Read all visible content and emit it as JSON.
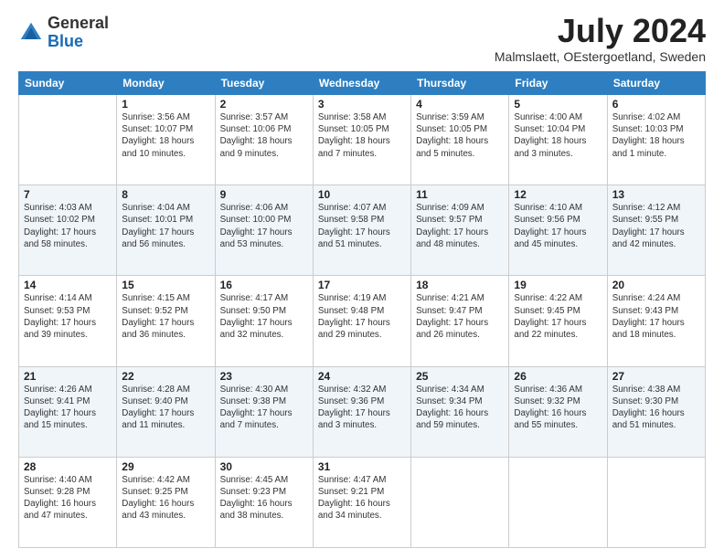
{
  "header": {
    "logo": {
      "general": "General",
      "blue": "Blue"
    },
    "title": "July 2024",
    "location": "Malmslaett, OEstergoetland, Sweden"
  },
  "calendar": {
    "headers": [
      "Sunday",
      "Monday",
      "Tuesday",
      "Wednesday",
      "Thursday",
      "Friday",
      "Saturday"
    ],
    "weeks": [
      [
        {
          "day": "",
          "info": ""
        },
        {
          "day": "1",
          "info": "Sunrise: 3:56 AM\nSunset: 10:07 PM\nDaylight: 18 hours\nand 10 minutes."
        },
        {
          "day": "2",
          "info": "Sunrise: 3:57 AM\nSunset: 10:06 PM\nDaylight: 18 hours\nand 9 minutes."
        },
        {
          "day": "3",
          "info": "Sunrise: 3:58 AM\nSunset: 10:05 PM\nDaylight: 18 hours\nand 7 minutes."
        },
        {
          "day": "4",
          "info": "Sunrise: 3:59 AM\nSunset: 10:05 PM\nDaylight: 18 hours\nand 5 minutes."
        },
        {
          "day": "5",
          "info": "Sunrise: 4:00 AM\nSunset: 10:04 PM\nDaylight: 18 hours\nand 3 minutes."
        },
        {
          "day": "6",
          "info": "Sunrise: 4:02 AM\nSunset: 10:03 PM\nDaylight: 18 hours\nand 1 minute."
        }
      ],
      [
        {
          "day": "7",
          "info": "Sunrise: 4:03 AM\nSunset: 10:02 PM\nDaylight: 17 hours\nand 58 minutes."
        },
        {
          "day": "8",
          "info": "Sunrise: 4:04 AM\nSunset: 10:01 PM\nDaylight: 17 hours\nand 56 minutes."
        },
        {
          "day": "9",
          "info": "Sunrise: 4:06 AM\nSunset: 10:00 PM\nDaylight: 17 hours\nand 53 minutes."
        },
        {
          "day": "10",
          "info": "Sunrise: 4:07 AM\nSunset: 9:58 PM\nDaylight: 17 hours\nand 51 minutes."
        },
        {
          "day": "11",
          "info": "Sunrise: 4:09 AM\nSunset: 9:57 PM\nDaylight: 17 hours\nand 48 minutes."
        },
        {
          "day": "12",
          "info": "Sunrise: 4:10 AM\nSunset: 9:56 PM\nDaylight: 17 hours\nand 45 minutes."
        },
        {
          "day": "13",
          "info": "Sunrise: 4:12 AM\nSunset: 9:55 PM\nDaylight: 17 hours\nand 42 minutes."
        }
      ],
      [
        {
          "day": "14",
          "info": "Sunrise: 4:14 AM\nSunset: 9:53 PM\nDaylight: 17 hours\nand 39 minutes."
        },
        {
          "day": "15",
          "info": "Sunrise: 4:15 AM\nSunset: 9:52 PM\nDaylight: 17 hours\nand 36 minutes."
        },
        {
          "day": "16",
          "info": "Sunrise: 4:17 AM\nSunset: 9:50 PM\nDaylight: 17 hours\nand 32 minutes."
        },
        {
          "day": "17",
          "info": "Sunrise: 4:19 AM\nSunset: 9:48 PM\nDaylight: 17 hours\nand 29 minutes."
        },
        {
          "day": "18",
          "info": "Sunrise: 4:21 AM\nSunset: 9:47 PM\nDaylight: 17 hours\nand 26 minutes."
        },
        {
          "day": "19",
          "info": "Sunrise: 4:22 AM\nSunset: 9:45 PM\nDaylight: 17 hours\nand 22 minutes."
        },
        {
          "day": "20",
          "info": "Sunrise: 4:24 AM\nSunset: 9:43 PM\nDaylight: 17 hours\nand 18 minutes."
        }
      ],
      [
        {
          "day": "21",
          "info": "Sunrise: 4:26 AM\nSunset: 9:41 PM\nDaylight: 17 hours\nand 15 minutes."
        },
        {
          "day": "22",
          "info": "Sunrise: 4:28 AM\nSunset: 9:40 PM\nDaylight: 17 hours\nand 11 minutes."
        },
        {
          "day": "23",
          "info": "Sunrise: 4:30 AM\nSunset: 9:38 PM\nDaylight: 17 hours\nand 7 minutes."
        },
        {
          "day": "24",
          "info": "Sunrise: 4:32 AM\nSunset: 9:36 PM\nDaylight: 17 hours\nand 3 minutes."
        },
        {
          "day": "25",
          "info": "Sunrise: 4:34 AM\nSunset: 9:34 PM\nDaylight: 16 hours\nand 59 minutes."
        },
        {
          "day": "26",
          "info": "Sunrise: 4:36 AM\nSunset: 9:32 PM\nDaylight: 16 hours\nand 55 minutes."
        },
        {
          "day": "27",
          "info": "Sunrise: 4:38 AM\nSunset: 9:30 PM\nDaylight: 16 hours\nand 51 minutes."
        }
      ],
      [
        {
          "day": "28",
          "info": "Sunrise: 4:40 AM\nSunset: 9:28 PM\nDaylight: 16 hours\nand 47 minutes."
        },
        {
          "day": "29",
          "info": "Sunrise: 4:42 AM\nSunset: 9:25 PM\nDaylight: 16 hours\nand 43 minutes."
        },
        {
          "day": "30",
          "info": "Sunrise: 4:45 AM\nSunset: 9:23 PM\nDaylight: 16 hours\nand 38 minutes."
        },
        {
          "day": "31",
          "info": "Sunrise: 4:47 AM\nSunset: 9:21 PM\nDaylight: 16 hours\nand 34 minutes."
        },
        {
          "day": "",
          "info": ""
        },
        {
          "day": "",
          "info": ""
        },
        {
          "day": "",
          "info": ""
        }
      ]
    ]
  }
}
